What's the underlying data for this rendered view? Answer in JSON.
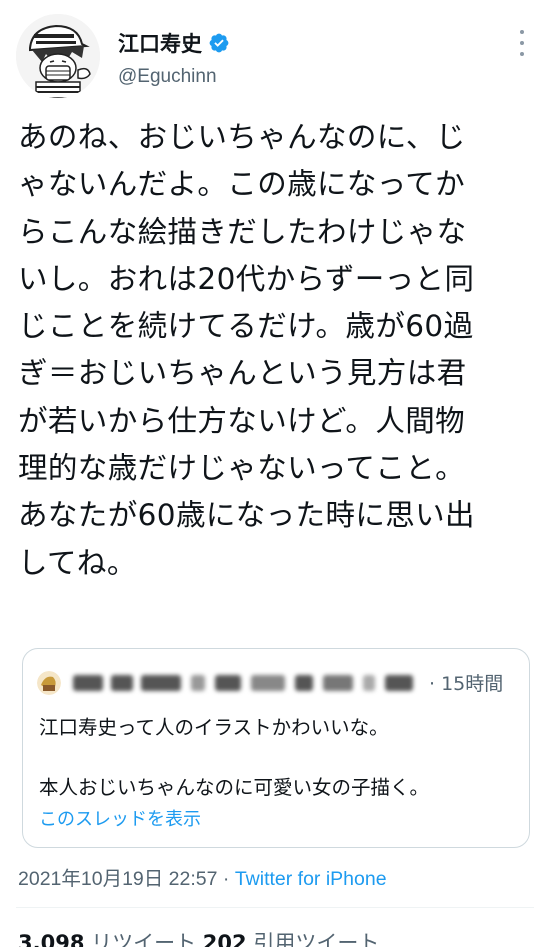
{
  "author": {
    "display_name": "江口寿史",
    "handle": "@Eguchinn"
  },
  "tweet_text": "あのね、おじいちゃんなのに、じゃないんだよ。この歳になってからこんな絵描きだしたわけじゃないし。おれは20代からずーっと同じことを続けてるだけ。歳が60過ぎ＝おじいちゃんという見方は君が若いから仕方ないけど。人間物理的な歳だけじゃないってこと。あなたが60歳になった時に思い出してね。",
  "tweet_lines": [
    "あのね、おじいちゃんなのに、じ",
    "ゃないんだよ。この歳になってか",
    "らこんな絵描きだしたわけじゃな",
    "いし。おれは20代からずーっと同",
    "じことを続けてるだけ。歳が60過",
    "ぎ＝おじいちゃんという見方は君",
    "が若いから仕方ないけど。人間物",
    "理的な歳だけじゃないってこと。",
    "あなたが60歳になった時に思い出",
    "してね。"
  ],
  "quote": {
    "time": "· 15時間",
    "line1": "江口寿史って人のイラストかわいいな。",
    "line2": "本人おじいちゃんなのに可愛い女の子描く。",
    "show_thread": "このスレッドを表示"
  },
  "meta": {
    "timestamp": "2021年10月19日 22:57 · ",
    "source": "Twitter for iPhone"
  },
  "stats": {
    "retweets_count": "3,098",
    "retweets_label": " リツイート ",
    "quotes_count": "202",
    "quotes_label": " 引用ツイート"
  },
  "colors": {
    "accent": "#1d9bf0",
    "secondary_text": "#536471",
    "border": "#cfd9de"
  },
  "icons": [
    "verified-badge-icon",
    "more-options-icon"
  ]
}
